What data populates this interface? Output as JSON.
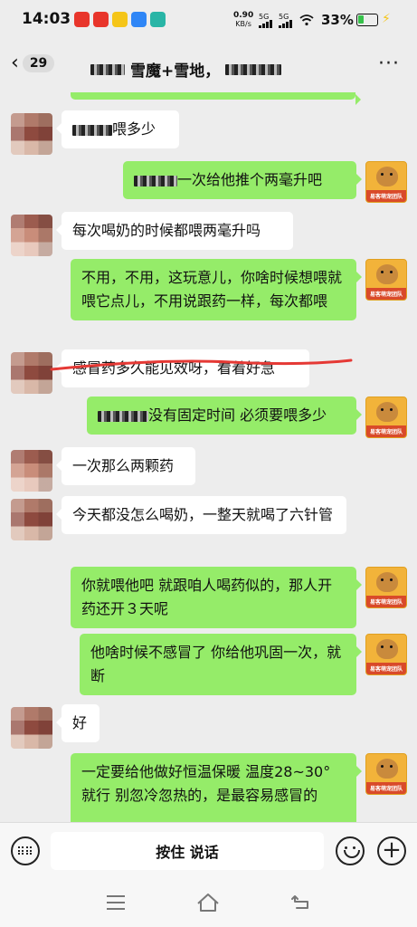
{
  "status_bar": {
    "time": "14:03",
    "app_badges": [
      {
        "label": "",
        "color": "#e8352b"
      },
      {
        "label": "",
        "color": "#e8352b"
      },
      {
        "label": "",
        "color": "#f5c518"
      },
      {
        "label": "",
        "color": "#2f86f6"
      },
      {
        "label": "",
        "color": "#29b5a6"
      }
    ],
    "net_speed_value": "0.90",
    "net_speed_unit": "KB/s",
    "sim1_label": "5G",
    "sim2_label": "5G",
    "battery_percent_text": "33%",
    "battery_level": 0.33,
    "battery_color": "#36c24a"
  },
  "header": {
    "unread_count": "29",
    "title_visible": "雪魔+雪地，"
  },
  "messages": [
    {
      "side": "in",
      "text": "喂多少"
    },
    {
      "side": "out",
      "text": "一次给他推个两毫升吧"
    },
    {
      "side": "in",
      "text": "每次喝奶的时候都喂两毫升吗"
    },
    {
      "side": "out",
      "text": "不用，不用，这玩意儿，你啥时候想喂就喂它点儿，不用说跟药一样，每次都喂"
    },
    {
      "side": "in",
      "text": "感冒药多久能见效呀，看着好急"
    },
    {
      "side": "out",
      "text": "没有固定时间 必须要喂多少"
    },
    {
      "side": "in",
      "text": "一次那么两颗药"
    },
    {
      "side": "in",
      "text": "今天都没怎么喝奶，一整天就喝了六针管"
    },
    {
      "side": "out",
      "text": "你就喂他吧 就跟咱人喝药似的，那人开药还开３天呢"
    },
    {
      "side": "out",
      "text": "他啥时候不感冒了 你给他巩固一次，就断"
    },
    {
      "side": "in",
      "text": "好"
    },
    {
      "side": "out",
      "text": "一定要给他做好恒温保暖 温度28~30° 就行  别忽冷忽热的，是最容易感冒的"
    }
  ],
  "self_avatar_label": "易客萌宠团队",
  "input_bar": {
    "hold_to_talk_label": "按住 说话"
  },
  "colors": {
    "incoming_bubble": "#ffffff",
    "outgoing_bubble": "#95ec69",
    "annotation_underline": "#e53935"
  }
}
